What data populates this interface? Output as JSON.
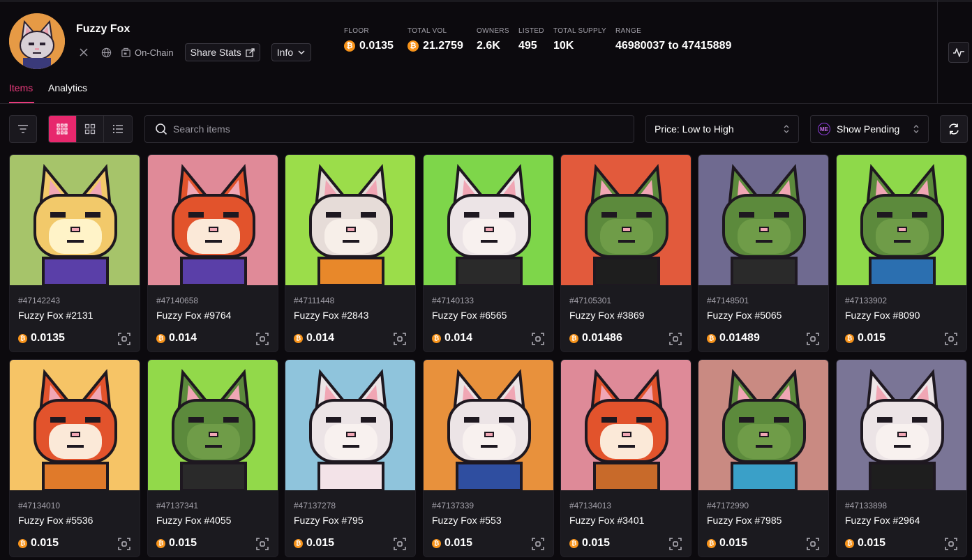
{
  "collection": {
    "name": "Fuzzy Fox",
    "onchain_label": "On-Chain",
    "share_label": "Share Stats",
    "info_label": "Info"
  },
  "stats": [
    {
      "label": "FLOOR",
      "value": "0.0135",
      "btc": true
    },
    {
      "label": "TOTAL VOL",
      "value": "21.2759",
      "btc": true
    },
    {
      "label": "OWNERS",
      "value": "2.6K",
      "btc": false
    },
    {
      "label": "LISTED",
      "value": "495",
      "btc": false
    },
    {
      "label": "TOTAL SUPPLY",
      "value": "10K",
      "btc": false
    },
    {
      "label": "RANGE",
      "value": "46980037 to 47415889",
      "btc": false
    }
  ],
  "tabs": {
    "items": "Items",
    "analytics": "Analytics"
  },
  "toolbar": {
    "search_placeholder": "Search items",
    "sort_value": "Price: Low to High",
    "pending_label": "Show Pending",
    "pending_badge": "ME"
  },
  "btc_symbol": "₿",
  "items": [
    {
      "id": "#47142243",
      "name": "Fuzzy Fox #2131",
      "price": "0.0135",
      "bg": "#a6c46a",
      "fur": "#f2c96a",
      "face": "#fff3c8",
      "body": "#5a3fa8"
    },
    {
      "id": "#47140658",
      "name": "Fuzzy Fox #9764",
      "price": "0.014",
      "bg": "#e08a98",
      "fur": "#e2532c",
      "face": "#fbe9d8",
      "body": "#5a3fa8"
    },
    {
      "id": "#47111448",
      "name": "Fuzzy Fox #2843",
      "price": "0.014",
      "bg": "#9bdd4a",
      "fur": "#e6dcd8",
      "face": "#f7efe9",
      "body": "#e8882a"
    },
    {
      "id": "#47140133",
      "name": "Fuzzy Fox #6565",
      "price": "0.014",
      "bg": "#7ed64a",
      "fur": "#ece4e6",
      "face": "#f8f1ef",
      "body": "#2a2a2a"
    },
    {
      "id": "#47105301",
      "name": "Fuzzy Fox #3869",
      "price": "0.01486",
      "bg": "#e25a3c",
      "fur": "#5c8a3c",
      "face": "#6f9c48",
      "body": "#1e1e1e"
    },
    {
      "id": "#47148501",
      "name": "Fuzzy Fox #5065",
      "price": "0.01489",
      "bg": "#6f6a90",
      "fur": "#5c8a3c",
      "face": "#6f9c48",
      "body": "#2a2a2a"
    },
    {
      "id": "#47133902",
      "name": "Fuzzy Fox #8090",
      "price": "0.015",
      "bg": "#8ed94a",
      "fur": "#5c8a3c",
      "face": "#6f9c48",
      "body": "#2b6fb0"
    },
    {
      "id": "#47134010",
      "name": "Fuzzy Fox #5536",
      "price": "0.015",
      "bg": "#f6c466",
      "fur": "#e2532c",
      "face": "#fbe9d8",
      "body": "#e07a2a"
    },
    {
      "id": "#47137341",
      "name": "Fuzzy Fox #4055",
      "price": "0.015",
      "bg": "#92d94a",
      "fur": "#5c8a3c",
      "face": "#6f9c48",
      "body": "#2a2a2a"
    },
    {
      "id": "#47137278",
      "name": "Fuzzy Fox #795",
      "price": "0.015",
      "bg": "#8fc4dc",
      "fur": "#ece4e6",
      "face": "#f8f1ef",
      "body": "#f3e3e8"
    },
    {
      "id": "#47137339",
      "name": "Fuzzy Fox #553",
      "price": "0.015",
      "bg": "#e8913c",
      "fur": "#ece4e6",
      "face": "#f8f1ef",
      "body": "#2f4ea0"
    },
    {
      "id": "#47134013",
      "name": "Fuzzy Fox #3401",
      "price": "0.015",
      "bg": "#de8a98",
      "fur": "#e2532c",
      "face": "#fbe9d8",
      "body": "#c86a2a"
    },
    {
      "id": "#47172990",
      "name": "Fuzzy Fox #7985",
      "price": "0.015",
      "bg": "#c98a82",
      "fur": "#5c8a3c",
      "face": "#6f9c48",
      "body": "#3aa0c8"
    },
    {
      "id": "#47133898",
      "name": "Fuzzy Fox #2964",
      "price": "0.015",
      "bg": "#7a7596",
      "fur": "#ece4e6",
      "face": "#f8f1ef",
      "body": "#1e1e1e"
    }
  ]
}
